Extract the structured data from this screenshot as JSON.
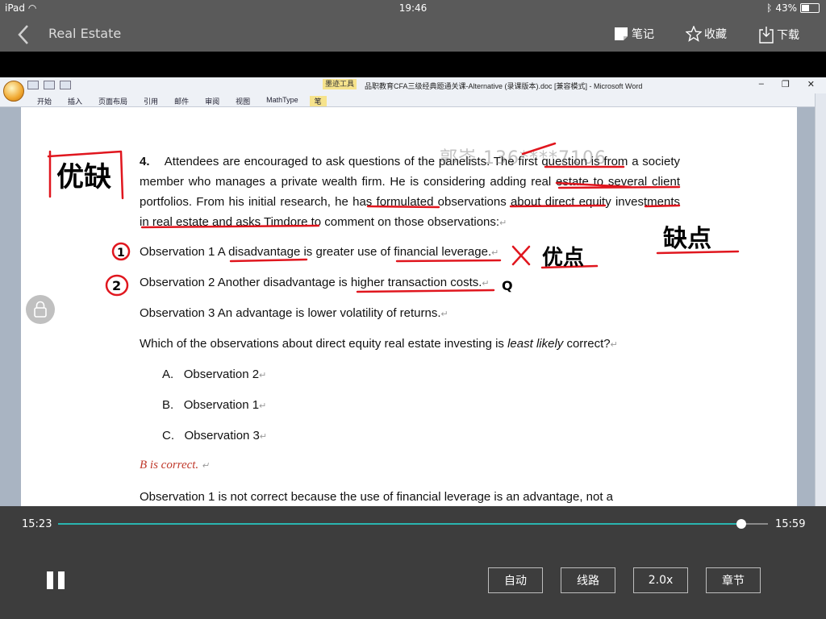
{
  "status": {
    "device": "iPad",
    "time": "19:46",
    "battery": "43%"
  },
  "nav": {
    "title": "Real Estate",
    "notes": "笔记",
    "favorite": "收藏",
    "download": "下载"
  },
  "word": {
    "window_title": "品职教育CFA三级经典题通关课-Alternative (录课版本).doc [兼容模式] - Microsoft Word",
    "tool_tab": "墨迹工具",
    "tabs": [
      "开始",
      "插入",
      "页面布局",
      "引用",
      "邮件",
      "审阅",
      "视图",
      "MathType",
      "笔"
    ]
  },
  "doc": {
    "question_num": "4.",
    "question_text": "Attendees are encouraged to ask questions of the panelists. The first question is from a society member who manages a private wealth firm. He is considering adding real estate to several client portfolios. From his initial research, he has formulated observations about direct equity investments in real estate and asks Timdore to comment on those observations:",
    "obs1": "Observation 1 A disadvantage is greater use of financial leverage.",
    "obs2": "Observation 2 Another disadvantage is higher transaction costs.",
    "obs3": "Observation 3 An advantage is lower volatility of returns.",
    "prompt_pre": "Which of the observations about direct equity real estate investing is ",
    "prompt_em": "least likely",
    "prompt_post": " correct?",
    "opt_a_label": "A.",
    "opt_a_text": "Observation 2",
    "opt_b_label": "B.",
    "opt_b_text": "Observation 1",
    "opt_c_label": "C.",
    "opt_c_text": "Observation 3",
    "answer": "B is correct.",
    "explanation": "Observation 1 is not correct because the use of financial leverage is an advantage, not a",
    "watermark": "郭岑 136****7106"
  },
  "ink": {
    "left_note": "优缺",
    "right_note": "缺点",
    "n1": "1",
    "n2": "2",
    "cross": "X",
    "adv": "优点",
    "q": "Q"
  },
  "player": {
    "current": "15:23",
    "duration": "15:59",
    "progress": 0.962,
    "btn_auto": "自动",
    "btn_route": "线路",
    "btn_speed": "2.0x",
    "btn_chapter": "章节"
  }
}
